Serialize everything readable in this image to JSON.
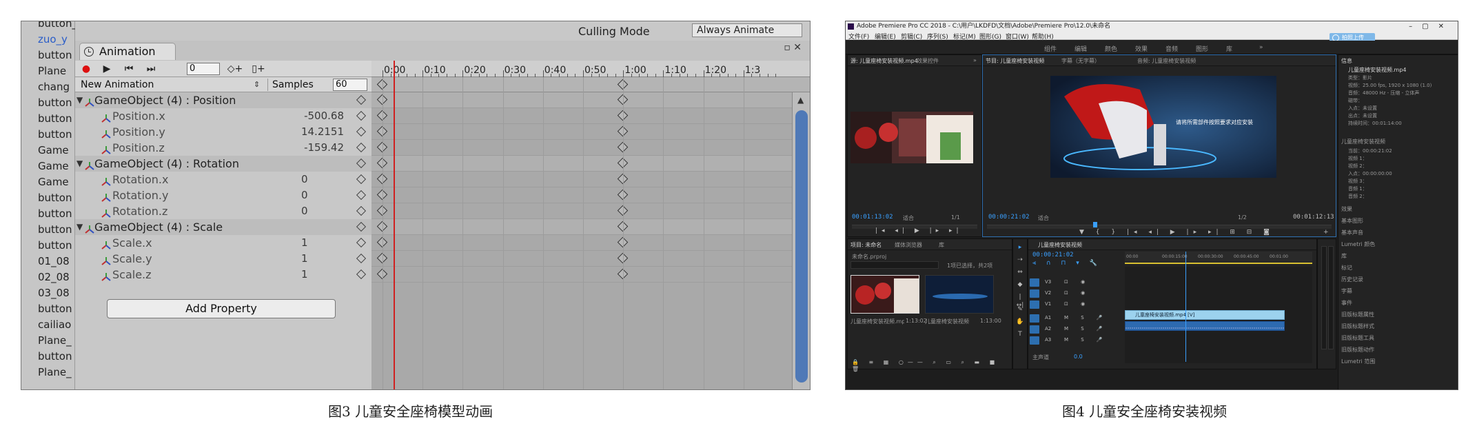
{
  "captions": {
    "left": "图3 儿童安全座椅模型动画",
    "right": "图4 儿童安全座椅安装视频"
  },
  "unity": {
    "hierarchy": [
      "button_modeling",
      "zuo_y",
      "button",
      "Plane",
      "chang",
      "button",
      "button",
      "button",
      "Game",
      "Game",
      "Game",
      "button",
      "button",
      "button",
      "button",
      "01_08",
      "02_08",
      "03_08",
      "button",
      "cailiao",
      "Plane_",
      "button",
      "Plane_"
    ],
    "hierarchy_selected_index": 1,
    "background_labels": {
      "culling_mode": "Culling Mode",
      "always_animate": "Always Animate"
    },
    "animation": {
      "tab_title": "Animation",
      "frame": "0",
      "clip": "New Animation",
      "samples_label": "Samples",
      "samples": "60",
      "ruler_ticks": [
        "0:00",
        "0:10",
        "0:20",
        "0:30",
        "0:40",
        "0:50",
        "1:00",
        "1:10",
        "1:20",
        "1:3"
      ],
      "add_property": "Add Property",
      "properties": [
        {
          "name": "GameObject (4) : Position",
          "group": true
        },
        {
          "name": "Position.x",
          "value": "-500.68"
        },
        {
          "name": "Position.y",
          "value": "14.2151"
        },
        {
          "name": "Position.z",
          "value": "-159.42"
        },
        {
          "name": "GameObject (4) : Rotation",
          "group": true
        },
        {
          "name": "Rotation.x",
          "value": "0"
        },
        {
          "name": "Rotation.y",
          "value": "0"
        },
        {
          "name": "Rotation.z",
          "value": "0"
        },
        {
          "name": "GameObject (4) : Scale",
          "group": true
        },
        {
          "name": "Scale.x",
          "value": "1"
        },
        {
          "name": "Scale.y",
          "value": "1"
        },
        {
          "name": "Scale.z",
          "value": "1"
        }
      ],
      "keyframes_at": [
        "0:00",
        "1:00"
      ]
    }
  },
  "premiere": {
    "title": "Adobe Premiere Pro CC 2018 - C:\\用户\\LKDFD\\文档\\Adobe\\Premiere Pro\\12.0\\未命名",
    "menu": [
      "文件(F)",
      "编辑(E)",
      "剪辑(C)",
      "序列(S)",
      "标记(M)",
      "图形(G)",
      "窗口(W)",
      "帮助(H)"
    ],
    "upload_label": "拍照上传",
    "workspaces": [
      "组件",
      "编辑",
      "颜色",
      "效果",
      "音频",
      "图形",
      "库"
    ],
    "source_tabs": [
      "源: 儿童座椅安装视频.mp4",
      "效果控件"
    ],
    "program_tabs": [
      "节目: 儿童座椅安装视频",
      "字幕（无字幕）",
      "音频: 儿童座椅安装视频"
    ],
    "source_tc_in": "00:01:13:02",
    "source_fit": "适合",
    "source_page": "1/1",
    "program_tc_in": "00:00:21:02",
    "program_fit": "适合",
    "program_page": "1/2",
    "program_tc_out": "00:01:12:13",
    "video_caption": "请将所需部件按照要求对应安装",
    "project_tabs": [
      "项目: 未命名",
      "媒体浏览器",
      "库"
    ],
    "project_file": "未命名.prproj",
    "project_count": "1项已选择，共2项",
    "bins": [
      {
        "label": "儿童座椅安装视频.mp4",
        "dur": "1:13:02"
      },
      {
        "label": "儿童座椅安装视频",
        "dur": "1:13:00"
      }
    ],
    "timeline_tab": "儿童座椅安装视频",
    "timeline_tc": "00:00:21:02",
    "timeline_ticks": [
      "00:00",
      "00:00:15:00",
      "00:00:30:00",
      "00:00:45:00",
      "00:01:00"
    ],
    "video_tracks": [
      "V3",
      "V2",
      "V1"
    ],
    "audio_tracks": [
      "A1",
      "A2",
      "A3"
    ],
    "master_label": "主声道",
    "master_value": "0.0",
    "clip_label": "儿童座椅安装视频.mp4 [V]",
    "info_title": "信息",
    "info_file": "儿童座椅安装视频.mp4",
    "info_lines": [
      "类型：影片",
      "视频：25.00 fps, 1920 x 1080 (1.0)",
      "音频：48000 Hz - 压缩 - 立体声",
      "磁带：",
      "入点：未设置",
      "出点：未设置",
      "持续时间：00:01:14:00"
    ],
    "info_section2": "儿童座椅安装视频",
    "info_lines2": [
      "当前：00:00:21:02",
      "视频 1：",
      "视频 2：",
      "入点：00:00:00:00",
      "视频 3：",
      "音频 1：",
      "音频 2："
    ],
    "right_panels": [
      "效果",
      "基本图形",
      "基本声音",
      "Lumetri 颜色",
      "库",
      "标记",
      "历史记录",
      "字幕",
      "事件",
      "旧版标题属性",
      "旧版标题样式",
      "旧版标题工具",
      "旧版标题动作",
      "Lumetri 范围"
    ]
  }
}
